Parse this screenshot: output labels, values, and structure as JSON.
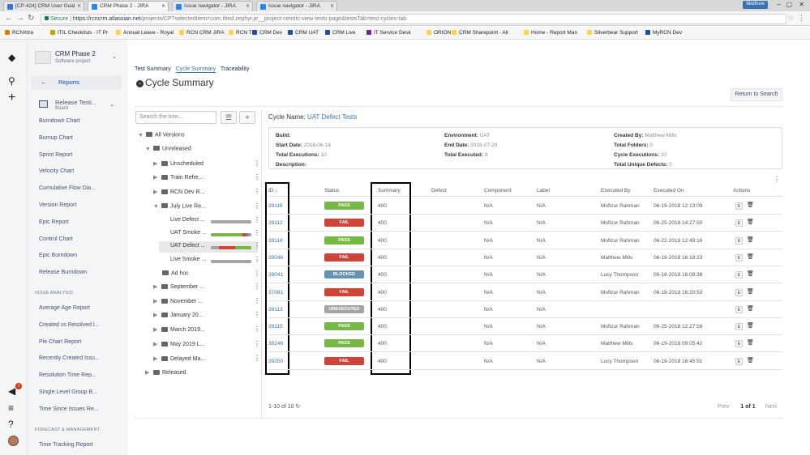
{
  "browser": {
    "tabs": [
      {
        "title": "[CP-424] CRM User Guid",
        "color": "#3b73d9"
      },
      {
        "title": "CRM Phase 2 - JIRA",
        "color": "#2684ff"
      },
      {
        "title": "Issue navigator - JIRA",
        "color": "#2684ff"
      },
      {
        "title": "Issue navigator - JIRA",
        "color": "#2684ff"
      }
    ],
    "user": "Matthew",
    "secure_label": "Secure",
    "url_host": "https://rcncrm.atlassian.net",
    "url_path": "/projects/CP?selectedItem=com.thed.zephyr.je__project-centric-view-tests-page&testsTab=test-cycles-tab",
    "bookmarks": [
      {
        "label": "RCNXtra",
        "color": "#e07a00"
      },
      {
        "label": "ITIL Checklists · IT Pr",
        "color": "#c9a400"
      },
      {
        "label": "Annual Leave - Royal",
        "color": "#ffd24d"
      },
      {
        "label": "RCN CRM JIRA",
        "color": "#ffd24d"
      },
      {
        "label": "RCN TP",
        "color": "#ffd24d"
      },
      {
        "label": "CRM Dev",
        "color": "#1f4fa3"
      },
      {
        "label": "CRM UAT",
        "color": "#1f4fa3"
      },
      {
        "label": "CRM Live",
        "color": "#1f4fa3"
      },
      {
        "label": "IT Service Desk",
        "color": "#7a1fa2"
      },
      {
        "label": "ORION",
        "color": "#ffd24d"
      },
      {
        "label": "CRM Sharepoint - All",
        "color": "#ffd24d"
      },
      {
        "label": "Home - Report Man",
        "color": "#ffd24d"
      },
      {
        "label": "Silverbear Support",
        "color": "#ffd24d"
      },
      {
        "label": "MyRCN Dev",
        "color": "#1f4fa3"
      }
    ]
  },
  "gnav": {
    "notification_count": "1"
  },
  "sidebar": {
    "project_name": "CRM Phase 2",
    "project_type": "Software project",
    "reports_label": "Reports",
    "board_name": "Release Testi...",
    "board_type": "Board",
    "items": [
      "Burndown Chart",
      "Burnup Chart",
      "Sprint Report",
      "Velocity Chart",
      "Cumulative Flow Dia...",
      "Version Report",
      "Epic Report",
      "Control Chart",
      "Epic Burndown",
      "Release Burndown"
    ],
    "issue_analysis_heading": "ISSUE ANALYSIS",
    "issue_analysis_items": [
      "Average Age Report",
      "Created vs Resolved I...",
      "Pie Chart Report",
      "Recently Created Issu...",
      "Resolution Time Rep...",
      "Single Level Group B...",
      "Time Since Issues Re..."
    ],
    "forecast_heading": "FORECAST & MANAGEMENT",
    "forecast_items": [
      "Time Tracking Report"
    ]
  },
  "main": {
    "tabs": [
      "Test Summary",
      "Cycle Summary",
      "Traceability"
    ],
    "title": "Cycle Summary",
    "return_button": "Return to Search",
    "search_placeholder": "Search the tree...",
    "tree": {
      "all_versions": "All Versions",
      "unreleased": "Unreleased",
      "items": [
        "Unscheduled",
        "Train Refre...",
        "RCN Dev R...",
        "July Live Re..."
      ],
      "cycles": [
        {
          "name": "Live Defect ...",
          "progress": [
            {
              "color": "#a5a5a5",
              "fraction": 1.0
            }
          ]
        },
        {
          "name": "UAT Smoke ...",
          "progress": [
            {
              "color": "#75b843",
              "fraction": 0.78
            },
            {
              "color": "#d04437",
              "fraction": 0.1
            },
            {
              "color": "#6693b0",
              "fraction": 0.06
            },
            {
              "color": "#a5a5a5",
              "fraction": 0.06
            }
          ]
        },
        {
          "name": "UAT Defect ...",
          "progress": [
            {
              "color": "#a5a5a5",
              "fraction": 0.2
            },
            {
              "color": "#d04437",
              "fraction": 0.4
            },
            {
              "color": "#75b843",
              "fraction": 0.4
            }
          ]
        },
        {
          "name": "Live Smoke ...",
          "progress": [
            {
              "color": "#a5a5a5",
              "fraction": 1.0
            }
          ]
        }
      ],
      "adhoc": "Ad hoc",
      "more": [
        "September ...",
        "November ...",
        "January 20...",
        "March 2019...",
        "May 2019 L...",
        "Delayed Ma..."
      ],
      "released": "Released"
    },
    "cycle": {
      "label": "Cycle Name:",
      "name": "UAT Defect Tests",
      "build_label": "Build:",
      "build": "",
      "start_label": "Start Date:",
      "start": "2018-06-14",
      "total_exec_label": "Total Executions:",
      "total_exec": "10",
      "desc_label": "Description:",
      "desc": "",
      "env_label": "Environment:",
      "env": "UAT",
      "end_label": "End Date:",
      "end": "2018-07-20",
      "total_executed_label": "Total Executed:",
      "total_executed": "9",
      "created_label": "Created By:",
      "created": "Matthew Mills",
      "folders_label": "Total Folders:",
      "folders": "0",
      "cycle_exec_label": "Cycle Executions:",
      "cycle_exec": "10",
      "defects_label": "Total Unique Defects:",
      "defects": "0"
    },
    "columns": [
      "ID",
      "Status",
      "Summary",
      "Defect",
      "Component",
      "Label",
      "Executed By",
      "Executed On",
      "Actions"
    ],
    "status_colors": {
      "PASS": "#75b843",
      "FAIL": "#d04437",
      "BLOCKED": "#6693b0",
      "UNEXECUTED": "#a5a5a5"
    },
    "rows": [
      {
        "id": "39116",
        "status": "PASS",
        "summary": "400",
        "component": "N/A",
        "label": "N/A",
        "by": "Mofizur Rahman",
        "on": "06-19-2018 12:13:09",
        "e": "E"
      },
      {
        "id": "39112",
        "status": "FAIL",
        "summary": "400",
        "component": "N/A",
        "label": "N/A",
        "by": "Mofizur Rahman",
        "on": "06-25-2018 14:27:50",
        "e": "E"
      },
      {
        "id": "39114",
        "status": "PASS",
        "summary": "400",
        "component": "N/A",
        "label": "N/A",
        "by": "Mofizur Rahman",
        "on": "06-22-2018 12:49:16",
        "e": "E"
      },
      {
        "id": "39048",
        "status": "FAIL",
        "summary": "400",
        "component": "N/A",
        "label": "N/A",
        "by": "Matthew Mills",
        "on": "06-18-2018 16:18:23",
        "e": "E"
      },
      {
        "id": "39041",
        "status": "BLOCKED",
        "summary": "400",
        "component": "N/A",
        "label": "N/A",
        "by": "Lucy Thompson",
        "on": "06-18-2018 16:08:38",
        "e": "E"
      },
      {
        "id": "37081",
        "status": "FAIL",
        "summary": "400",
        "component": "N/A",
        "label": "N/A",
        "by": "Mofizur Rahman",
        "on": "06-18-2018 16:20:53",
        "e": "E"
      },
      {
        "id": "39113",
        "status": "UNEXECUTED",
        "summary": "400",
        "component": "N/A",
        "label": "N/A",
        "by": "",
        "on": "",
        "e": "E"
      },
      {
        "id": "39115",
        "status": "PASS",
        "summary": "400",
        "component": "N/A",
        "label": "N/A",
        "by": "Mofizur Rahman",
        "on": "06-25-2018 12:27:58",
        "e": "E"
      },
      {
        "id": "39246",
        "status": "PASS",
        "summary": "400",
        "component": "N/A",
        "label": "N/A",
        "by": "Matthew Mills",
        "on": "06-19-2018 09:05:42",
        "e": "E"
      },
      {
        "id": "39250",
        "status": "FAIL",
        "summary": "400",
        "component": "N/A",
        "label": "N/A",
        "by": "Lucy Thompson",
        "on": "06-18-2018 16:45:51",
        "e": "E"
      }
    ],
    "pager": {
      "range": "1-10 of 10",
      "prev": "Prev",
      "page": "1 of 1",
      "next": "Next"
    }
  }
}
